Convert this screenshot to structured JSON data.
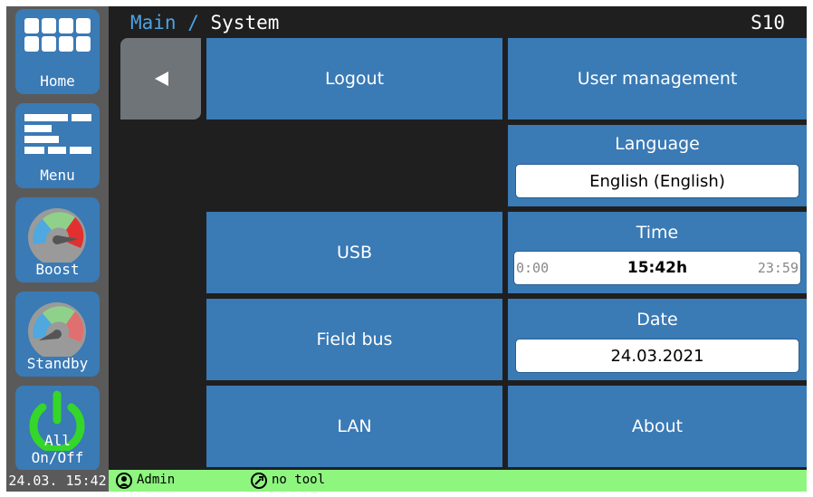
{
  "sidebar": {
    "items": [
      {
        "label": "Home",
        "icon": "grid-icon"
      },
      {
        "label": "Menu",
        "icon": "menu-bars-icon"
      },
      {
        "label": "Boost",
        "icon": "boost-gauge-icon"
      },
      {
        "label": "Standby",
        "icon": "standby-gauge-icon"
      },
      {
        "label": "All On/Off",
        "icon": "power-icon"
      }
    ]
  },
  "header": {
    "breadcrumb_main": "Main",
    "breadcrumb_sep": " / ",
    "breadcrumb_current": "System",
    "device_id": "S10"
  },
  "tiles": {
    "logout": "Logout",
    "user_management": "User management",
    "language_label": "Language",
    "language_value": "English (English)",
    "usb": "USB",
    "time_label": "Time",
    "time_min": "0:00",
    "time_value": "15:42h",
    "time_max": "23:59",
    "field_bus": "Field bus",
    "date_label": "Date",
    "date_value": "24.03.2021",
    "lan": "LAN",
    "about": "About"
  },
  "status": {
    "clock": "24.03. 15:42",
    "user": "Admin",
    "tool": "no tool"
  },
  "colors": {
    "tile_blue": "#3a7ab5",
    "status_green": "#8ef57f",
    "breadcrumb_accent": "#4ba3e3"
  }
}
